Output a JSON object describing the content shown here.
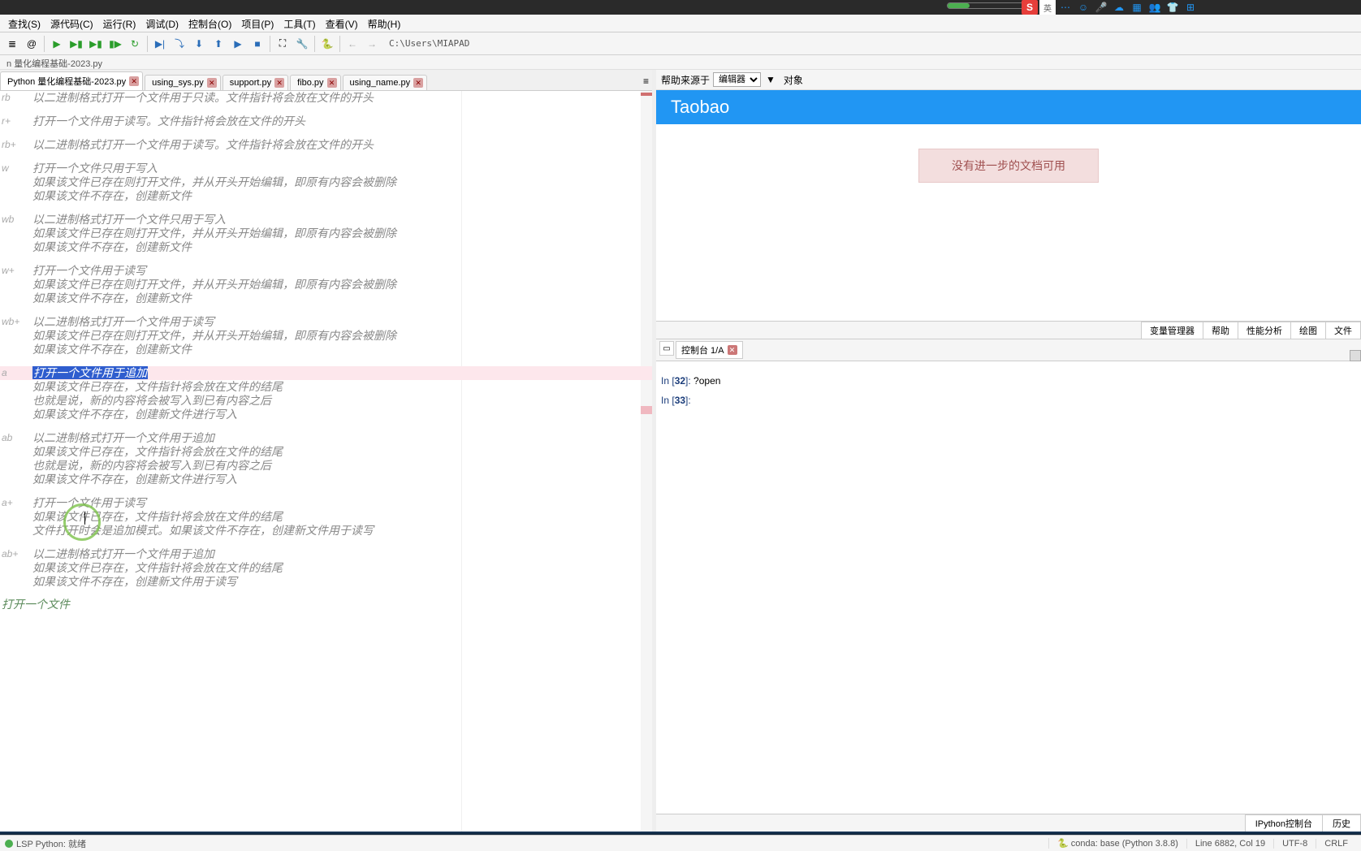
{
  "menubar": [
    "查找(S)",
    "源代码(C)",
    "运行(R)",
    "调试(D)",
    "控制台(O)",
    "项目(P)",
    "工具(T)",
    "查看(V)",
    "帮助(H)"
  ],
  "path": "C:\\Users\\MIAPAD",
  "crumb": "量化编程基础-2023.py",
  "tabs": [
    {
      "label": "Python 量化编程基础-2023.py",
      "active": true
    },
    {
      "label": "using_sys.py",
      "active": false
    },
    {
      "label": "support.py",
      "active": false
    },
    {
      "label": "fibo.py",
      "active": false
    },
    {
      "label": "using_name.py",
      "active": false
    }
  ],
  "editor_blocks": [
    {
      "mode": "rb",
      "lines": [
        "以二进制格式打开一个文件用于只读。文件指针将会放在文件的开头"
      ]
    },
    {
      "mode": "r+",
      "lines": [
        "打开一个文件用于读写。文件指针将会放在文件的开头"
      ]
    },
    {
      "mode": "rb+",
      "lines": [
        "以二进制格式打开一个文件用于读写。文件指针将会放在文件的开头"
      ]
    },
    {
      "mode": "w",
      "lines": [
        "打开一个文件只用于写入",
        "如果该文件已存在则打开文件，并从开头开始编辑，即原有内容会被删除",
        "如果该文件不存在，创建新文件"
      ]
    },
    {
      "mode": "wb",
      "lines": [
        "以二进制格式打开一个文件只用于写入",
        "如果该文件已存在则打开文件，并从开头开始编辑，即原有内容会被删除",
        "如果该文件不存在，创建新文件"
      ]
    },
    {
      "mode": "w+",
      "lines": [
        "打开一个文件用于读写",
        "如果该文件已存在则打开文件，并从开头开始编辑，即原有内容会被删除",
        "如果该文件不存在，创建新文件"
      ]
    },
    {
      "mode": "wb+",
      "lines": [
        "以二进制格式打开一个文件用于读写",
        "如果该文件已存在则打开文件，并从开头开始编辑，即原有内容会被删除",
        "如果该文件不存在，创建新文件"
      ]
    },
    {
      "mode": "a",
      "sel": 0,
      "lines": [
        "打开一个文件用于追加",
        "如果该文件已存在，文件指针将会放在文件的结尾",
        "也就是说，新的内容将会被写入到已有内容之后",
        "如果该文件不存在，创建新文件进行写入"
      ]
    },
    {
      "mode": "ab",
      "lines": [
        "以二进制格式打开一个文件用于追加",
        "如果该文件已存在，文件指针将会放在文件的结尾",
        "也就是说，新的内容将会被写入到已有内容之后",
        "如果该文件不存在，创建新文件进行写入"
      ]
    },
    {
      "mode": "a+",
      "lines": [
        "打开一个文件用于读写",
        "如果该文件已存在，文件指针将会放在文件的结尾",
        "文件打开时会是追加模式。如果该文件不存在，创建新文件用于读写"
      ]
    },
    {
      "mode": "ab+",
      "lines": [
        "以二进制格式打开一个文件用于追加",
        "如果该文件已存在，文件指针将会放在文件的结尾",
        "如果该文件不存在，创建新文件用于读写"
      ]
    }
  ],
  "last_visible_line": "打开一个文件",
  "help": {
    "source_label": "帮助来源于",
    "select_value": "编辑器",
    "object_label": "对象",
    "banner": "Taobao",
    "message": "没有进一步的文档可用",
    "tabs": [
      "变量管理器",
      "帮助",
      "性能分析",
      "绘图",
      "文件"
    ]
  },
  "console": {
    "tab": "控制台 1/A",
    "lines": [
      {
        "n": "32",
        "body": "?open"
      },
      {
        "n": "33",
        "body": ""
      }
    ],
    "bottom_tabs": [
      "IPython控制台",
      "历史"
    ]
  },
  "status": {
    "lsp": "LSP Python: 就绪",
    "conda": "conda: base (Python 3.8.8)",
    "pos": "Line 6882, Col 19",
    "enc": "UTF-8",
    "eol": "CRLF"
  },
  "tray": {
    "ime": "S",
    "lang": "英"
  }
}
